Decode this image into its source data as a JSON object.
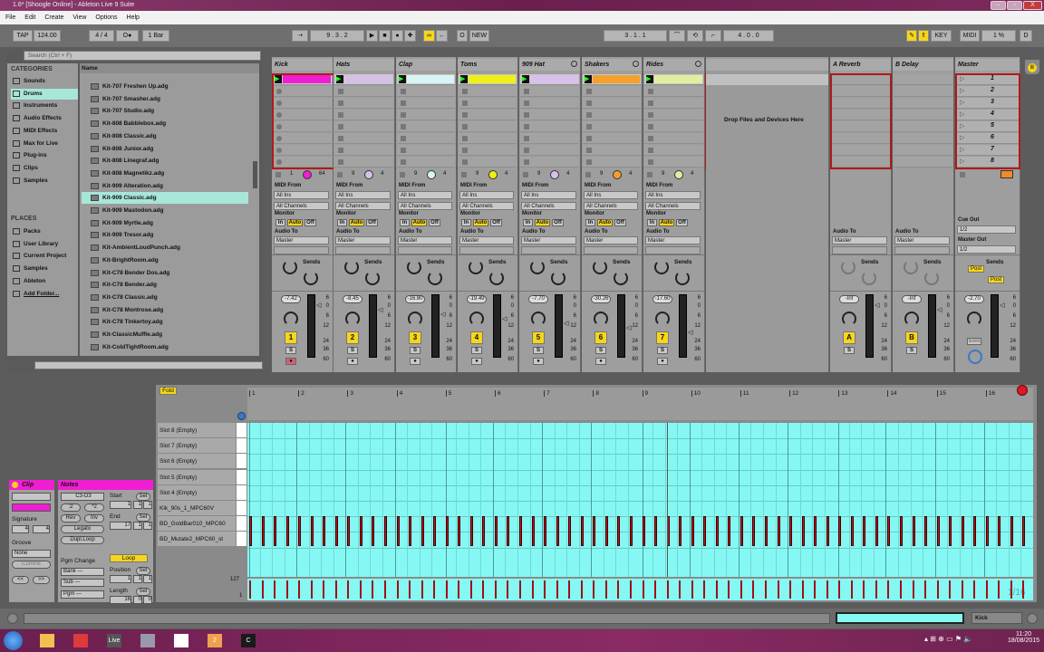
{
  "window": {
    "title": "1.6*  [Shoogle Online] - Ableton Live 9 Suite",
    "min": "–",
    "max": "▫",
    "close": "X"
  },
  "menu": [
    "File",
    "Edit",
    "Create",
    "View",
    "Options",
    "Help"
  ],
  "control": {
    "tap": "TAP",
    "tempo": "124.00",
    "sig": "4 / 4",
    "metro": "O●",
    "quant": "1 Bar",
    "position": "9 .  3 .  2",
    "new": "NEW",
    "loop_start": "3 .  1 .  1",
    "loop_len": "4 .  0 .  0",
    "key": "KEY",
    "midi": "MIDI",
    "cpu": "1 %",
    "d": "D"
  },
  "browser": {
    "search_placeholder": "Search (Ctrl + F)",
    "categories_title": "CATEGORIES",
    "categories": [
      "Sounds",
      "Drums",
      "Instruments",
      "Audio Effects",
      "MIDI Effects",
      "Max for Live",
      "Plug-ins",
      "Clips",
      "Samples"
    ],
    "selected_category": "Drums",
    "places_title": "PLACES",
    "places": [
      "Packs",
      "User Library",
      "Current Project",
      "Samples",
      "Ableton",
      "Add Folder..."
    ],
    "name_header": "Name",
    "files": [
      "Kit-707 Freshen Up.adg",
      "Kit-707 Smasher.adg",
      "Kit-707 Studio.adg",
      "Kit-808 Babblebox.adg",
      "Kit-808 Classic.adg",
      "Kit-808 Junior.adg",
      "Kit-808 Linegraf.adg",
      "Kit-808 Magnetikz.adg",
      "Kit-909 Alteration.adg",
      "Kit-909 Classic.adg",
      "Kit-909 Mastodon.adg",
      "Kit-909 Myrtle.adg",
      "Kit-909 Tresor.adg",
      "Kit-AmbientLoudPunch.adg",
      "Kit-BrightRoom.adg",
      "Kit-C78 Bender Dos.adg",
      "Kit-C78 Bender.adg",
      "Kit-C78 Classic.adg",
      "Kit-C78 Montrose.adg",
      "Kit-C78 Tinkertoy.adg",
      "Kit-ClassicMuffle.adg",
      "Kit-ColdTightRoom.adg"
    ],
    "selected_file": "Kit-909 Classic.adg"
  },
  "labels": {
    "midi_from": "MIDI From",
    "all_ins": "All Ins",
    "all_channels": "All Channels",
    "monitor": "Monitor",
    "in": "In",
    "auto": "Auto",
    "off": "Off",
    "audio_to": "Audio To",
    "master": "Master",
    "sends": "Sends",
    "a": "A",
    "b": "B",
    "s": "S",
    "drop": "Drop Files and Devices Here",
    "cue_out": "Cue Out",
    "master_out": "Master Out",
    "half": "1/2",
    "post": "Post",
    "solo": "Solo"
  },
  "tracks": [
    {
      "name": "Kick",
      "color": "#f01ed2",
      "vol": "-7.42",
      "num": "1",
      "in": "1",
      "out": "64",
      "armed": true
    },
    {
      "name": "Hats",
      "color": "#d7c0e6",
      "vol": "-8.45",
      "num": "2",
      "in": "9",
      "out": "4"
    },
    {
      "name": "Clap",
      "color": "#d8f5f5",
      "vol": "-16.80",
      "num": "3",
      "in": "9",
      "out": "4"
    },
    {
      "name": "Toms",
      "color": "#eef016",
      "vol": "-19.49",
      "num": "4",
      "in": "9",
      "out": "4"
    },
    {
      "name": "909 Hat",
      "color": "#d8c0ea",
      "vol": "-7.70",
      "num": "5",
      "in": "9",
      "out": "4"
    },
    {
      "name": "Shakers",
      "color": "#f5a02a",
      "vol": "-30.26",
      "num": "6",
      "in": "9",
      "out": "4"
    },
    {
      "name": "Rides",
      "color": "#e0eea0",
      "vol": "-17.60",
      "num": "7",
      "in": "9",
      "out": "4"
    }
  ],
  "returns": [
    {
      "name": "A Reverb",
      "vol": "-Inf",
      "letter": "A"
    },
    {
      "name": "B Delay",
      "vol": "-Inf",
      "letter": "B"
    }
  ],
  "master": {
    "name": "Master",
    "vol": "-2.70",
    "scenes": [
      "1",
      "2",
      "3",
      "4",
      "5",
      "6",
      "7",
      "8"
    ]
  },
  "meter_scale": [
    "6",
    "0",
    "6",
    "12",
    "24",
    "36",
    "60"
  ],
  "clip": {
    "title": "Clip",
    "signature_label": "Signature",
    "sig_num": "4",
    "sig_den": "4",
    "groove_label": "Groove",
    "groove": "None",
    "commit": "Commit",
    "prev": "<<",
    "next": ">>"
  },
  "notes_panel": {
    "title": "Notes",
    "range": "C3-D3",
    "div2": ":2",
    "mul2": "*2",
    "rev": "Rev",
    "inv": "Inv",
    "legato": "Legato",
    "dupl": "Dupl.Loop",
    "start": "Start",
    "end": "End",
    "set": "Set",
    "start_val": [
      "1",
      "1",
      "1"
    ],
    "end_val": [
      "17",
      "1",
      "1"
    ],
    "loop": "Loop",
    "position": "Position",
    "pos_val": [
      "1",
      "1",
      "1"
    ],
    "length": "Length",
    "len_val": [
      "16",
      "0",
      "0"
    ],
    "pgm_change": "Pgm Change",
    "bank": "Bank ---",
    "sub": "Sub ---",
    "pgm": "Pgm ---"
  },
  "editor": {
    "fold": "Fold",
    "bars": [
      "1",
      "2",
      "3",
      "4",
      "5",
      "6",
      "7",
      "8",
      "9",
      "10",
      "11",
      "12",
      "13",
      "14",
      "15",
      "16"
    ],
    "rows": [
      "Slot 8 (Empty)",
      "Slot 7 (Empty)",
      "Slot 6 (Empty)",
      "Slot 5 (Empty)",
      "Slot 4 (Empty)",
      "Kik_90s_1_MPC60V",
      "BD_GoldBar010_MPC60",
      "BD_Mutate2_MPC60_st"
    ],
    "vel_max": "127",
    "vel_min": "1",
    "grid": "1/16",
    "notes_per_bar": 4,
    "note_rows": [
      "BD_GoldBar010_MPC60",
      "BD_Mutate2_MPC60_st"
    ]
  },
  "statusbar": {
    "track": "Kick"
  },
  "taskbar": {
    "apps": [
      "Explorer",
      "Chrome",
      "Live",
      "Media",
      "Apps",
      "2",
      "C"
    ],
    "time": "11:20",
    "date": "18/08/2015"
  }
}
